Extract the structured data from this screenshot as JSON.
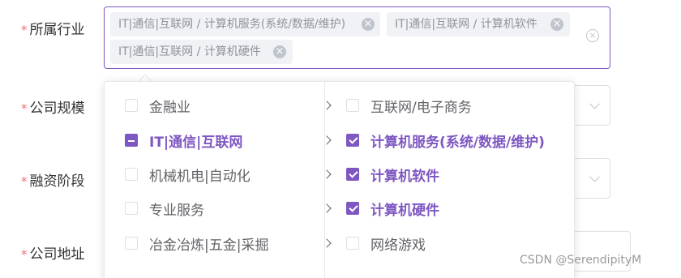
{
  "form": {
    "labels": {
      "industry": "所属行业",
      "size": "公司规模",
      "funding": "融资阶段",
      "address": "公司地址"
    },
    "required_mark": "*"
  },
  "industry_select": {
    "tags": [
      "IT|通信|互联网 / 计算机服务(系统/数据/维护)",
      "IT|通信|互联网 / 计算机软件",
      "IT|通信|互联网 / 计算机硬件"
    ],
    "tag_close_glyph": "×",
    "clear_glyph": "×"
  },
  "cascader": {
    "level1": [
      {
        "label": "金融业",
        "state": "unchecked"
      },
      {
        "label": "IT|通信|互联网",
        "state": "indeterminate",
        "active": true
      },
      {
        "label": "机械机电|自动化",
        "state": "unchecked"
      },
      {
        "label": "专业服务",
        "state": "unchecked"
      },
      {
        "label": "冶金冶炼|五金|采掘",
        "state": "unchecked"
      }
    ],
    "level2": [
      {
        "label": "互联网/电子商务",
        "state": "unchecked"
      },
      {
        "label": "计算机服务(系统/数据/维护)",
        "state": "checked"
      },
      {
        "label": "计算机软件",
        "state": "checked"
      },
      {
        "label": "计算机硬件",
        "state": "checked"
      },
      {
        "label": "网络游戏",
        "state": "unchecked"
      }
    ]
  },
  "watermark": "CSDN @SerendipityM",
  "colors": {
    "accent": "#7e57c2",
    "required": "#f56c6c",
    "border": "#dcdfe6"
  }
}
